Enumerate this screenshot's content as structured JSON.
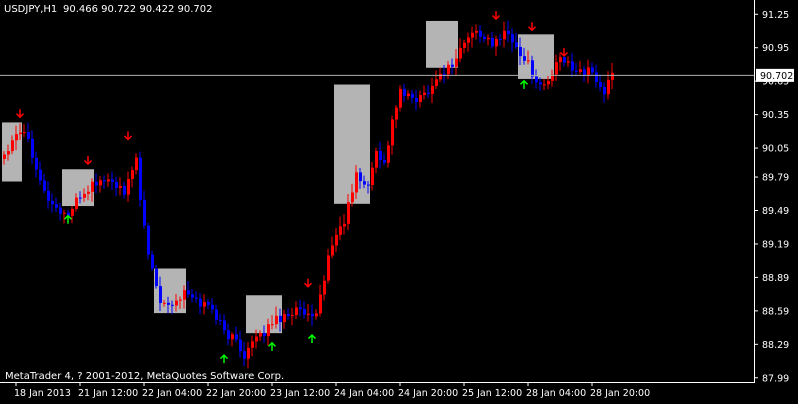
{
  "header": {
    "symbol_timeframe": "USDJPY,H1",
    "ohlc": "90.466 90.722 90.422 90.702"
  },
  "footer": {
    "copyright": "MetaTrader 4, ? 2001-2012, MetaQuotes Software Corp."
  },
  "colors": {
    "background": "#000000",
    "bull_candle": "#ff0000",
    "bear_candle": "#0000ff",
    "axis": "#ffffff",
    "zone_box": "#b4b4b4",
    "up_arrow": "#00ff00",
    "down_arrow": "#ff0000",
    "price_line": "#c0c0c0"
  },
  "icons": {
    "buy_signal": "up-arrow-icon",
    "sell_signal": "down-arrow-icon"
  },
  "chart_data": {
    "type": "candlestick",
    "symbol": "USDJPY",
    "timeframe": "H1",
    "current_price": 90.702,
    "current_price_label": "90.702",
    "ylim": [
      87.97,
      91.36
    ],
    "y_ticks": [
      {
        "value": 91.25,
        "label": "91.25"
      },
      {
        "value": 90.95,
        "label": "90.95"
      },
      {
        "value": 90.65,
        "label": "90.65"
      },
      {
        "value": 90.35,
        "label": "90.35"
      },
      {
        "value": 90.05,
        "label": "90.05"
      },
      {
        "value": 89.79,
        "label": "89.79"
      },
      {
        "value": 89.49,
        "label": "89.49"
      },
      {
        "value": 89.19,
        "label": "89.19"
      },
      {
        "value": 88.89,
        "label": "88.89"
      },
      {
        "value": 88.59,
        "label": "88.59"
      },
      {
        "value": 88.29,
        "label": "88.29"
      },
      {
        "value": 87.99,
        "label": "87.99"
      }
    ],
    "x_ticks": [
      {
        "bar": 3,
        "label": "18 Jan 2013"
      },
      {
        "bar": 19,
        "label": "21 Jan 12:00"
      },
      {
        "bar": 35,
        "label": "22 Jan 04:00"
      },
      {
        "bar": 51,
        "label": "22 Jan 20:00"
      },
      {
        "bar": 67,
        "label": "23 Jan 12:00"
      },
      {
        "bar": 83,
        "label": "24 Jan 04:00"
      },
      {
        "bar": 99,
        "label": "24 Jan 20:00"
      },
      {
        "bar": 115,
        "label": "25 Jan 12:00"
      },
      {
        "bar": 131,
        "label": "28 Jan 04:00"
      },
      {
        "bar": 147,
        "label": "28 Jan 20:00"
      }
    ],
    "anchors": [
      [
        0,
        90.0
      ],
      [
        3,
        90.2
      ],
      [
        5,
        90.22
      ],
      [
        8,
        89.9
      ],
      [
        10,
        89.65
      ],
      [
        13,
        89.5
      ],
      [
        16,
        89.45
      ],
      [
        19,
        89.62
      ],
      [
        22,
        89.72
      ],
      [
        25,
        89.77
      ],
      [
        28,
        89.72
      ],
      [
        30,
        89.62
      ],
      [
        32,
        89.85
      ],
      [
        33,
        90.0
      ],
      [
        34,
        89.55
      ],
      [
        36,
        89.1
      ],
      [
        39,
        88.7
      ],
      [
        42,
        88.65
      ],
      [
        45,
        88.75
      ],
      [
        48,
        88.68
      ],
      [
        52,
        88.62
      ],
      [
        55,
        88.4
      ],
      [
        58,
        88.32
      ],
      [
        60,
        88.2
      ],
      [
        62,
        88.3
      ],
      [
        64,
        88.35
      ],
      [
        67,
        88.5
      ],
      [
        70,
        88.55
      ],
      [
        73,
        88.6
      ],
      [
        75,
        88.55
      ],
      [
        77,
        88.5
      ],
      [
        78,
        88.55
      ],
      [
        80,
        88.9
      ],
      [
        82,
        89.2
      ],
      [
        85,
        89.4
      ],
      [
        88,
        89.8
      ],
      [
        91,
        89.7
      ],
      [
        93,
        90.05
      ],
      [
        95,
        89.9
      ],
      [
        97,
        90.3
      ],
      [
        99,
        90.55
      ],
      [
        101,
        90.5
      ],
      [
        104,
        90.5
      ],
      [
        107,
        90.62
      ],
      [
        110,
        90.75
      ],
      [
        112,
        90.8
      ],
      [
        115,
        91.0
      ],
      [
        118,
        91.1
      ],
      [
        120,
        91.05
      ],
      [
        122,
        90.95
      ],
      [
        125,
        91.12
      ],
      [
        128,
        90.95
      ],
      [
        131,
        90.8
      ],
      [
        134,
        90.6
      ],
      [
        136,
        90.65
      ],
      [
        139,
        90.85
      ],
      [
        141,
        90.8
      ],
      [
        144,
        90.75
      ],
      [
        147,
        90.72
      ],
      [
        150,
        90.55
      ],
      [
        152,
        90.7
      ]
    ],
    "zones": [
      {
        "from_bar": 0,
        "to_bar": 4,
        "top": 90.28,
        "bottom": 89.75
      },
      {
        "from_bar": 15,
        "to_bar": 22,
        "top": 89.86,
        "bottom": 89.53
      },
      {
        "from_bar": 38,
        "to_bar": 45,
        "top": 88.97,
        "bottom": 88.57
      },
      {
        "from_bar": 61,
        "to_bar": 69,
        "top": 88.73,
        "bottom": 88.39
      },
      {
        "from_bar": 83,
        "to_bar": 91,
        "top": 90.62,
        "bottom": 89.55
      },
      {
        "from_bar": 106,
        "to_bar": 113,
        "top": 91.19,
        "bottom": 90.77
      },
      {
        "from_bar": 129,
        "to_bar": 137,
        "top": 91.07,
        "bottom": 90.67
      }
    ],
    "up_arrows": [
      {
        "bar": 16,
        "price": 89.47
      },
      {
        "bar": 55,
        "price": 88.22
      },
      {
        "bar": 67,
        "price": 88.33
      },
      {
        "bar": 77,
        "price": 88.4
      },
      {
        "bar": 130,
        "price": 90.68
      }
    ],
    "down_arrows": [
      {
        "bar": 4,
        "price": 90.3
      },
      {
        "bar": 21,
        "price": 89.88
      },
      {
        "bar": 31,
        "price": 90.1
      },
      {
        "bar": 76,
        "price": 88.78
      },
      {
        "bar": 123,
        "price": 91.18
      },
      {
        "bar": 132,
        "price": 91.08
      },
      {
        "bar": 140,
        "price": 90.85
      }
    ]
  }
}
